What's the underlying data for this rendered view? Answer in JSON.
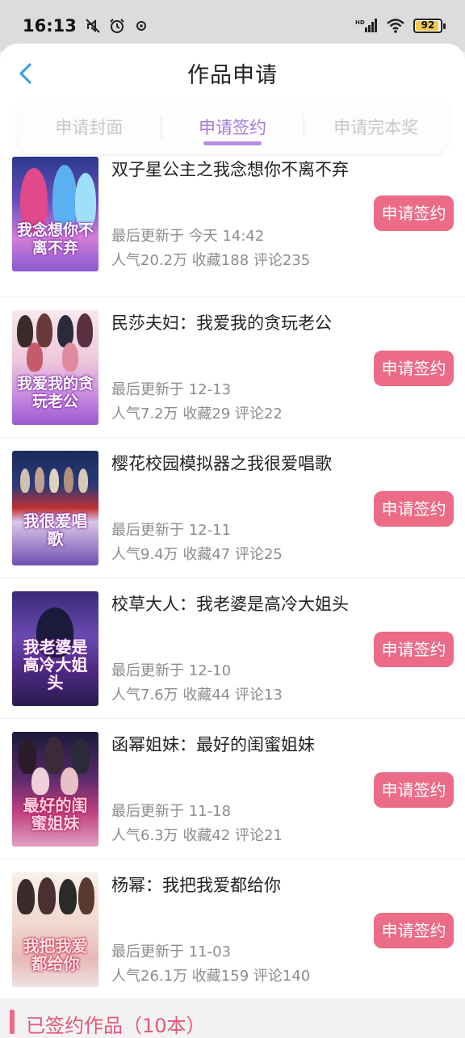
{
  "status_bar": {
    "time": "16:13",
    "battery": "92"
  },
  "header": {
    "title": "作品申请"
  },
  "tabs": [
    {
      "label": "申请封面",
      "active": false
    },
    {
      "label": "申请签约",
      "active": true
    },
    {
      "label": "申请完本奖",
      "active": false
    }
  ],
  "apply_button_label": "申请签约",
  "books": [
    {
      "title": "双子星公主之我念想你不离不弃",
      "updated": "最后更新于 今天 14:42",
      "stats": "人气20.2万  收藏188  评论235",
      "cover_text": "我念想你不离不弃"
    },
    {
      "title": "民莎夫妇：我爱我的贪玩老公",
      "updated": "最后更新于 12-13",
      "stats": "人气7.2万  收藏29  评论22",
      "cover_text": "我爱我的贪玩老公"
    },
    {
      "title": "樱花校园模拟器之我很爱唱歌",
      "updated": "最后更新于 12-11",
      "stats": "人气9.4万  收藏47  评论25",
      "cover_text": "我很爱唱歌"
    },
    {
      "title": "校草大人：我老婆是高冷大姐头",
      "updated": "最后更新于 12-10",
      "stats": "人气7.6万  收藏44  评论13",
      "cover_text": "我老婆是高冷大姐头"
    },
    {
      "title": "函幂姐妹：最好的闺蜜姐妹",
      "updated": "最后更新于 11-18",
      "stats": "人气6.3万  收藏42  评论21",
      "cover_text": "最好的闺蜜姐妹"
    },
    {
      "title": "杨幂：我把我爱都给你",
      "updated": "最后更新于 11-03",
      "stats": "人气26.1万  收藏159  评论140",
      "cover_text": "我把我爱都给你"
    }
  ],
  "signed_section": {
    "label": "已签约作品（10本）"
  },
  "colors": {
    "accent": "#ec6b86",
    "tab_active": "#a77ad9"
  }
}
